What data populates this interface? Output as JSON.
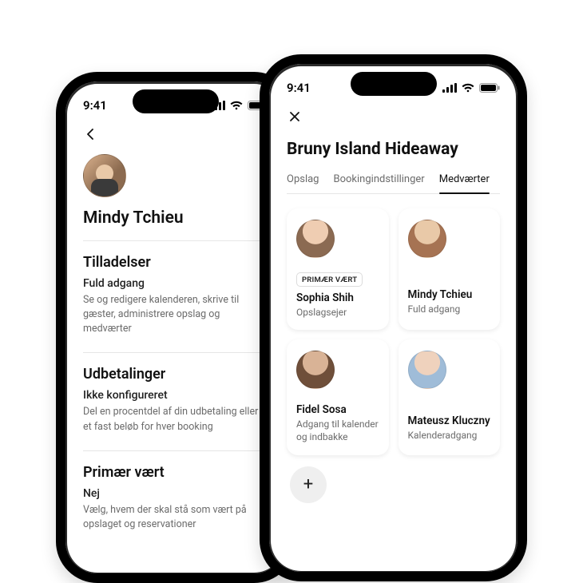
{
  "status": {
    "time": "9:41"
  },
  "left": {
    "profile_name": "Mindy Tchieu",
    "sections": {
      "permissions": {
        "title": "Tilladelser",
        "sub": "Fuld adgang",
        "desc": "Se og redigere kalenderen, skrive til gæster, administrere opslag og medværter"
      },
      "payouts": {
        "title": "Udbetalinger",
        "sub": "Ikke konfigureret",
        "desc": "Del en procentdel af din udbetaling eller et fast beløb for hver booking"
      },
      "primary": {
        "title": "Primær vært",
        "sub": "Nej",
        "desc": "Vælg, hvem der skal stå som vært på opslaget og reservationer"
      }
    }
  },
  "right": {
    "listing_title": "Bruny Island Hideaway",
    "tabs": {
      "t0": "Opslag",
      "t1": "Bookingindstillinger",
      "t2": "Medværter"
    },
    "badge_primary": "PRIMÆR VÆRT",
    "cohosts": [
      {
        "name": "Sophia Shih",
        "role": "Opslagsejer",
        "primary": true
      },
      {
        "name": "Mindy Tchieu",
        "role": "Fuld adgang",
        "primary": false
      },
      {
        "name": "Fidel Sosa",
        "role": "Adgang til kalender og indbakke",
        "primary": false
      },
      {
        "name": "Mateusz Kluczny",
        "role": "Kalenderadgang",
        "primary": false
      }
    ],
    "add_label": "+"
  }
}
